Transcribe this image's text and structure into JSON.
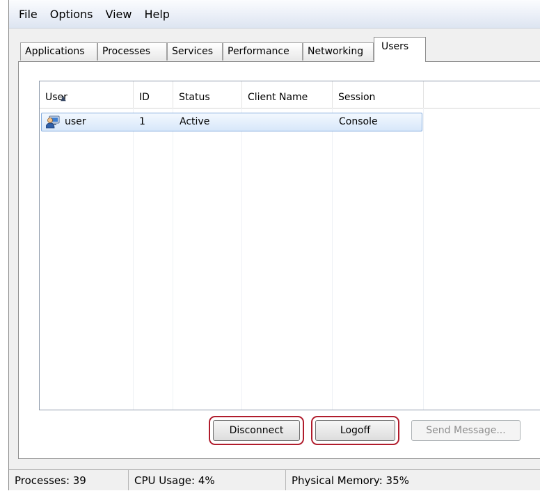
{
  "menu": [
    "File",
    "Options",
    "View",
    "Help"
  ],
  "tabs": {
    "applications": "Applications",
    "processes": "Processes",
    "services": "Services",
    "performance": "Performance",
    "networking": "Networking",
    "users": "Users"
  },
  "list": {
    "columns": {
      "user": "User",
      "id": "ID",
      "status": "Status",
      "client_name": "Client Name",
      "session": "Session"
    },
    "sorted_column": "User",
    "sort_direction": "ascending",
    "rows": [
      {
        "icon": "user-icon",
        "user": "user",
        "id": "1",
        "status": "Active",
        "client_name": "",
        "session": "Console",
        "selected": true
      }
    ]
  },
  "buttons": {
    "disconnect": "Disconnect",
    "logoff": "Logoff",
    "send_message": "Send Message..."
  },
  "statusbar": {
    "processes": "Processes: 39",
    "cpu": "CPU Usage: 4%",
    "memory": "Physical Memory: 35%"
  },
  "colors": {
    "highlight_outline": "#b01c2c",
    "selection": "#d7e7fa"
  }
}
